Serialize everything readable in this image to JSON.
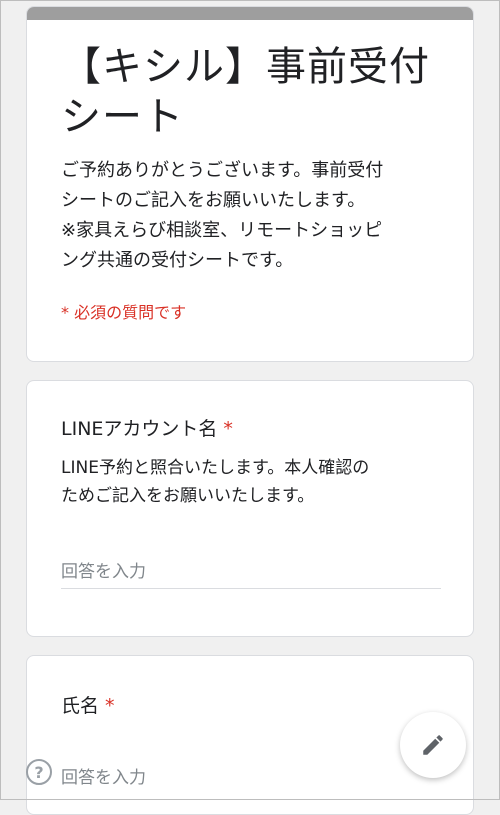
{
  "form": {
    "title": "【キシル】事前受付シート",
    "description_lines": [
      "ご予約ありがとうございます。事前受付",
      "シートのご記入をお願いいたします。",
      "※家具えらび相談室、リモートショッピ",
      "ング共通の受付シートです。"
    ],
    "required_note": "* 必須の質問です",
    "header_color": "#9e9e9e",
    "required_color": "#d93025"
  },
  "questions": [
    {
      "title": "LINEアカウント名",
      "required_mark": "*",
      "description_lines": [
        "LINE予約と照合いたします。本人確認の",
        "ためご記入をお願いいたします。"
      ],
      "placeholder": "回答を入力"
    },
    {
      "title": "氏名",
      "required_mark": "*",
      "placeholder": "回答を入力"
    }
  ],
  "fab": {
    "icon": "pencil-icon"
  },
  "help": {
    "icon": "help-icon",
    "glyph": "?"
  }
}
